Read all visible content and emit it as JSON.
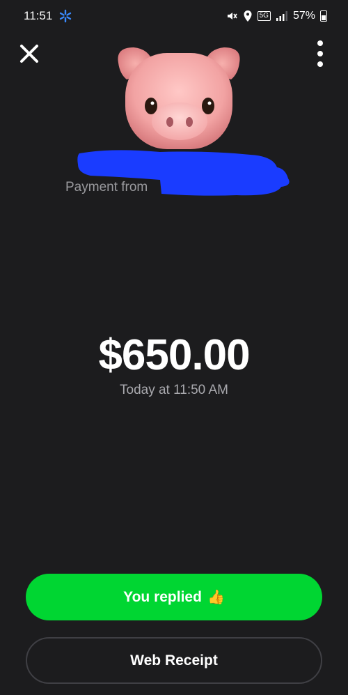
{
  "status_bar": {
    "time": "11:51",
    "battery": "57%",
    "network": "5G"
  },
  "header": {
    "close_icon": "close-icon",
    "more_icon": "more-vertical-icon"
  },
  "profile": {
    "avatar": "pig-face-emoji",
    "payment_label": "Payment from"
  },
  "transaction": {
    "amount": "$650.00",
    "timestamp": "Today at 11:50 AM"
  },
  "actions": {
    "replied_label": "You replied",
    "replied_emoji": "👍",
    "receipt_label": "Web Receipt"
  },
  "colors": {
    "background": "#1c1c1e",
    "accent_green": "#00d632",
    "redaction_blue": "#1a3cff"
  }
}
